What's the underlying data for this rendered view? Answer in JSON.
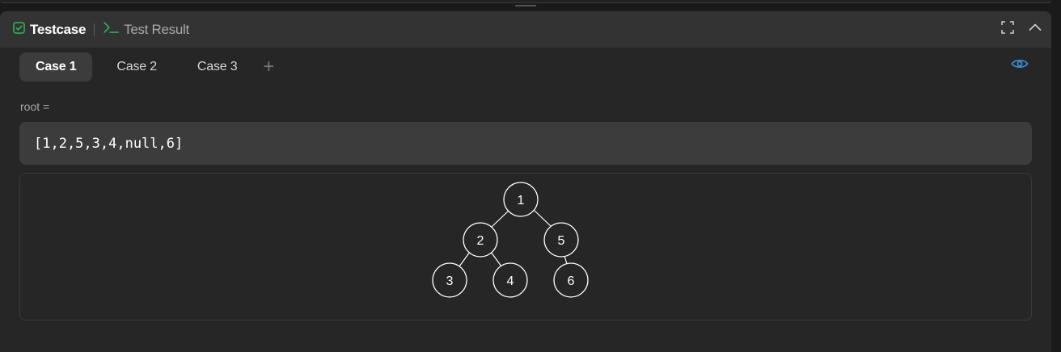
{
  "header": {
    "tabs": [
      {
        "label": "Testcase",
        "icon": "checkbox-icon",
        "active": true,
        "color": "#2cbb5d"
      },
      {
        "label": "Test Result",
        "icon": "terminal-icon",
        "active": false,
        "color": "#2cbb5d"
      }
    ],
    "actions": [
      "fullscreen-icon",
      "collapse-chevron-icon"
    ]
  },
  "cases": {
    "tabs": [
      "Case 1",
      "Case 2",
      "Case 3"
    ],
    "active_index": 0,
    "add_label": "+"
  },
  "input": {
    "var_label": "root =",
    "value": "[1,2,5,3,4,null,6]"
  },
  "tree": {
    "nodes": [
      "1",
      "2",
      "5",
      "3",
      "4",
      "6"
    ]
  },
  "colors": {
    "accent_green": "#2cbb5d",
    "accent_blue": "#3a8fd9"
  }
}
